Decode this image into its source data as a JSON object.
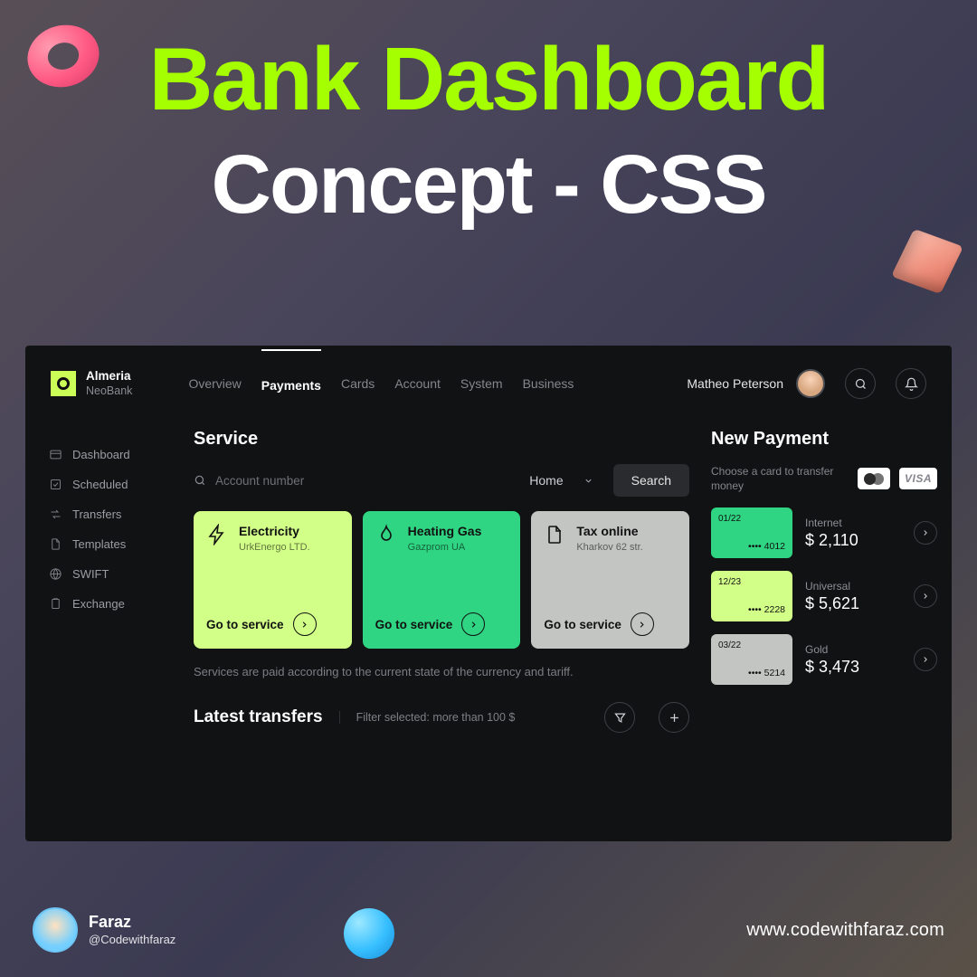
{
  "hero": {
    "line1": "Bank Dashboard",
    "line2": "Concept - CSS"
  },
  "brand": {
    "name": "Almeria",
    "sub": "NeoBank"
  },
  "tabs": [
    "Overview",
    "Payments",
    "Cards",
    "Account",
    "System",
    "Business"
  ],
  "active_tab": "Payments",
  "user": {
    "name": "Matheo Peterson"
  },
  "sidebar": [
    "Dashboard",
    "Scheduled",
    "Transfers",
    "Templates",
    "SWIFT",
    "Exchange"
  ],
  "service": {
    "title": "Service",
    "placeholder": "Account number",
    "dropdown": "Home",
    "search_btn": "Search",
    "tiles": [
      {
        "title": "Electricity",
        "sub": "UrkEnergo LTD.",
        "cta": "Go to service"
      },
      {
        "title": "Heating Gas",
        "sub": "Gazprom UA",
        "cta": "Go to service"
      },
      {
        "title": "Tax online",
        "sub": "Kharkov 62 str.",
        "cta": "Go to service"
      }
    ],
    "note": "Services are paid according to the current state of the currency and tariff."
  },
  "transfers": {
    "title": "Latest transfers",
    "filter": "Filter selected: more than 100 $"
  },
  "new_payment": {
    "title": "New Payment",
    "sub": "Choose a card to transfer money",
    "visa_label": "VISA",
    "rows": [
      {
        "exp": "01/22",
        "last": "•••• 4012",
        "label": "Internet",
        "amount": "$ 2,110"
      },
      {
        "exp": "12/23",
        "last": "•••• 2228",
        "label": "Universal",
        "amount": "$ 5,621"
      },
      {
        "exp": "03/22",
        "last": "•••• 5214",
        "label": "Gold",
        "amount": "$ 3,473"
      }
    ]
  },
  "footer": {
    "name": "Faraz",
    "handle": "@Codewithfaraz",
    "site": "www.codewithfaraz.com"
  }
}
